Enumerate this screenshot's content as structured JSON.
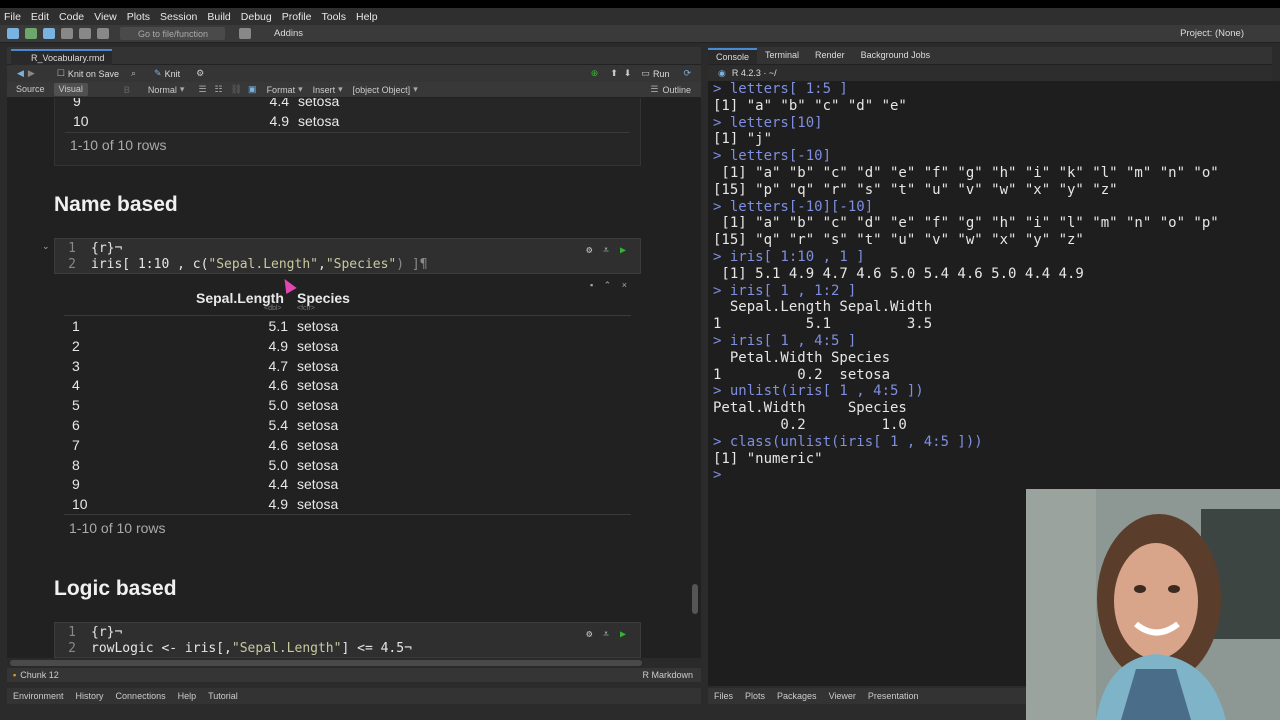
{
  "menubar": [
    "File",
    "Edit",
    "Code",
    "View",
    "Plots",
    "Session",
    "Build",
    "Debug",
    "Profile",
    "Tools",
    "Help"
  ],
  "toolbar": {
    "goto_placeholder": "Go to file/function",
    "addins": "Addins",
    "project": "Project: (None)"
  },
  "editor": {
    "tab_name": "R_Vocabulary.rmd",
    "knit_on_save": "Knit on Save",
    "knit": "Knit",
    "run": "Run",
    "source": "Source",
    "visual": "Visual",
    "style": "Normal",
    "format": "Format",
    "insert": "Insert",
    "table": {
      "col1": "Sepal.Length",
      "col1_type": "<dbl>",
      "col2": "Species",
      "col2_type": "<fctr>",
      "rows": [
        {
          "idx": "1",
          "val": "5.1",
          "sp": "setosa"
        },
        {
          "idx": "2",
          "val": "4.9",
          "sp": "setosa"
        },
        {
          "idx": "3",
          "val": "4.7",
          "sp": "setosa"
        },
        {
          "idx": "4",
          "val": "4.6",
          "sp": "setosa"
        },
        {
          "idx": "5",
          "val": "5.0",
          "sp": "setosa"
        },
        {
          "idx": "6",
          "val": "5.4",
          "sp": "setosa"
        },
        {
          "idx": "7",
          "val": "4.6",
          "sp": "setosa"
        },
        {
          "idx": "8",
          "val": "5.0",
          "sp": "setosa"
        },
        {
          "idx": "9",
          "val": "4.4",
          "sp": "setosa"
        },
        {
          "idx": "10",
          "val": "4.9",
          "sp": "setosa"
        }
      ],
      "footer": "1-10 of 10 rows"
    },
    "outline": "Outline",
    "top_table": {
      "rows": [
        {
          "idx": "9",
          "val": "4.4",
          "sp": "setosa"
        },
        {
          "idx": "10",
          "val": "4.9",
          "sp": "setosa"
        }
      ],
      "footer": "1-10 of 10 rows"
    },
    "heading1": "Name based",
    "chunk1": {
      "line1_num": "1",
      "line1": "{r}¬",
      "line2_num": "2",
      "line2_a": "iris[ 1:10 , c(",
      "line2_s1": "\"Sepal.Length\"",
      "line2_b": ",",
      "line2_s2": "\"Species\"",
      "line2_c": ") ]¶"
    },
    "heading2": "Logic based",
    "chunk2": {
      "line1_num": "1",
      "line1": "{r}¬",
      "line2_num": "2",
      "line2_a": "rowLogic <- iris[,",
      "line2_s": "\"Sepal.Length\"",
      "line2_b": "] <= 4.5¬"
    },
    "status_chunk": "Chunk 12",
    "status_mode": "R Markdown"
  },
  "console": {
    "tabs": [
      "Console",
      "Terminal",
      "Render",
      "Background Jobs"
    ],
    "version": "R 4.2.3 · ~/",
    "lines": [
      {
        "t": "in",
        "s": "> letters[ 1:5 ]"
      },
      {
        "t": "out",
        "s": "[1] \"a\" \"b\" \"c\" \"d\" \"e\""
      },
      {
        "t": "in",
        "s": "> letters[10]"
      },
      {
        "t": "out",
        "s": "[1] \"j\""
      },
      {
        "t": "in",
        "s": "> letters[-10]"
      },
      {
        "t": "out",
        "s": " [1] \"a\" \"b\" \"c\" \"d\" \"e\" \"f\" \"g\" \"h\" \"i\" \"k\" \"l\" \"m\" \"n\" \"o\""
      },
      {
        "t": "out",
        "s": "[15] \"p\" \"q\" \"r\" \"s\" \"t\" \"u\" \"v\" \"w\" \"x\" \"y\" \"z\""
      },
      {
        "t": "in",
        "s": "> letters[-10][-10]"
      },
      {
        "t": "out",
        "s": " [1] \"a\" \"b\" \"c\" \"d\" \"e\" \"f\" \"g\" \"h\" \"i\" \"l\" \"m\" \"n\" \"o\" \"p\""
      },
      {
        "t": "out",
        "s": "[15] \"q\" \"r\" \"s\" \"t\" \"u\" \"v\" \"w\" \"x\" \"y\" \"z\""
      },
      {
        "t": "in",
        "s": "> iris[ 1:10 , 1 ]"
      },
      {
        "t": "out",
        "s": " [1] 5.1 4.9 4.7 4.6 5.0 5.4 4.6 5.0 4.4 4.9"
      },
      {
        "t": "in",
        "s": "> iris[ 1 , 1:2 ]"
      },
      {
        "t": "out",
        "s": "  Sepal.Length Sepal.Width"
      },
      {
        "t": "out",
        "s": "1          5.1         3.5"
      },
      {
        "t": "in",
        "s": "> iris[ 1 , 4:5 ]"
      },
      {
        "t": "out",
        "s": "  Petal.Width Species"
      },
      {
        "t": "out",
        "s": "1         0.2  setosa"
      },
      {
        "t": "in",
        "s": "> unlist(iris[ 1 , 4:5 ])"
      },
      {
        "t": "out",
        "s": "Petal.Width     Species"
      },
      {
        "t": "out",
        "s": "        0.2         1.0"
      },
      {
        "t": "in",
        "s": "> class(unlist(iris[ 1 , 4:5 ]))"
      },
      {
        "t": "out",
        "s": "[1] \"numeric\""
      },
      {
        "t": "in",
        "s": "> "
      }
    ]
  },
  "bottom_left_tabs": [
    "Environment",
    "History",
    "Connections",
    "Help",
    "Tutorial"
  ],
  "bottom_right_tabs": [
    "Files",
    "Plots",
    "Packages",
    "Viewer",
    "Presentation"
  ]
}
